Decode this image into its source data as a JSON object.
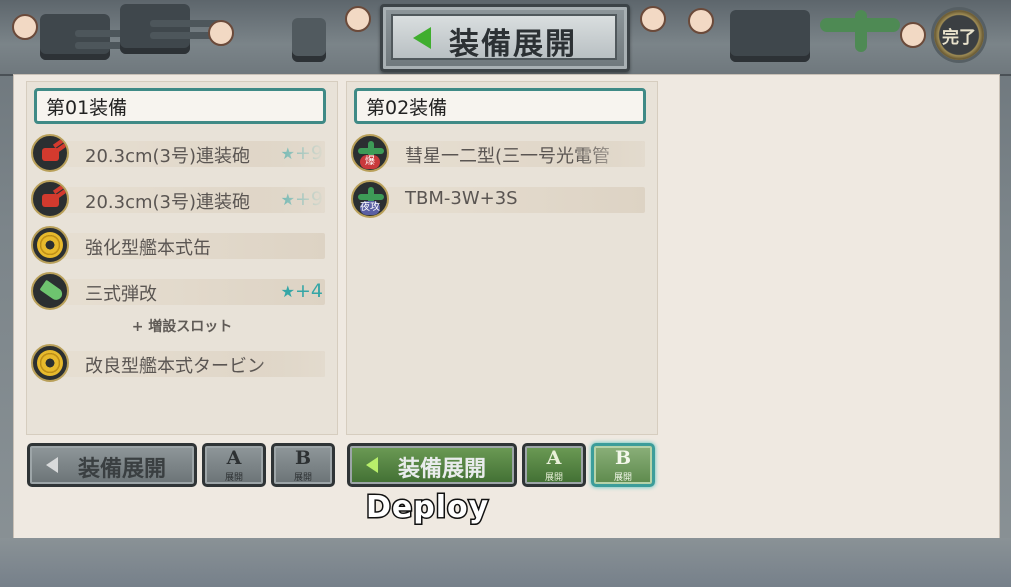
{
  "header": {
    "title": "装備展開",
    "done_label": "完了"
  },
  "columns": [
    {
      "title": "第01装備",
      "items": [
        {
          "name": "20.3cm(3号)連装砲",
          "icon": "gun-red-icon",
          "stars": "+9"
        },
        {
          "name": "20.3cm(3号)連装砲",
          "icon": "gun-red-icon",
          "stars": "+9"
        },
        {
          "name": "強化型艦本式缶",
          "icon": "boiler-gear-icon",
          "stars": ""
        },
        {
          "name": "三式弾改",
          "icon": "shell-green-icon",
          "stars": "+4"
        }
      ],
      "expansion_label": "+ 増設スロット",
      "expansion_item": {
        "name": "改良型艦本式タービン",
        "icon": "turbine-gear-icon"
      }
    },
    {
      "title": "第02装備",
      "items": [
        {
          "name": "彗星一二型(三一号光電管",
          "icon": "dive-bomber-icon",
          "badge": "爆"
        },
        {
          "name": "TBM-3W+3S",
          "icon": "night-plane-icon",
          "badge": "夜攻"
        }
      ]
    }
  ],
  "buttons": {
    "deploy_label": "装備展開",
    "a_label": "A",
    "b_label": "B",
    "sub_label": "展開"
  },
  "caption": "Deploy",
  "colors": {
    "accent_teal": "#3f8a86",
    "star_color": "#35a6a6",
    "green_button": "#416f33"
  }
}
